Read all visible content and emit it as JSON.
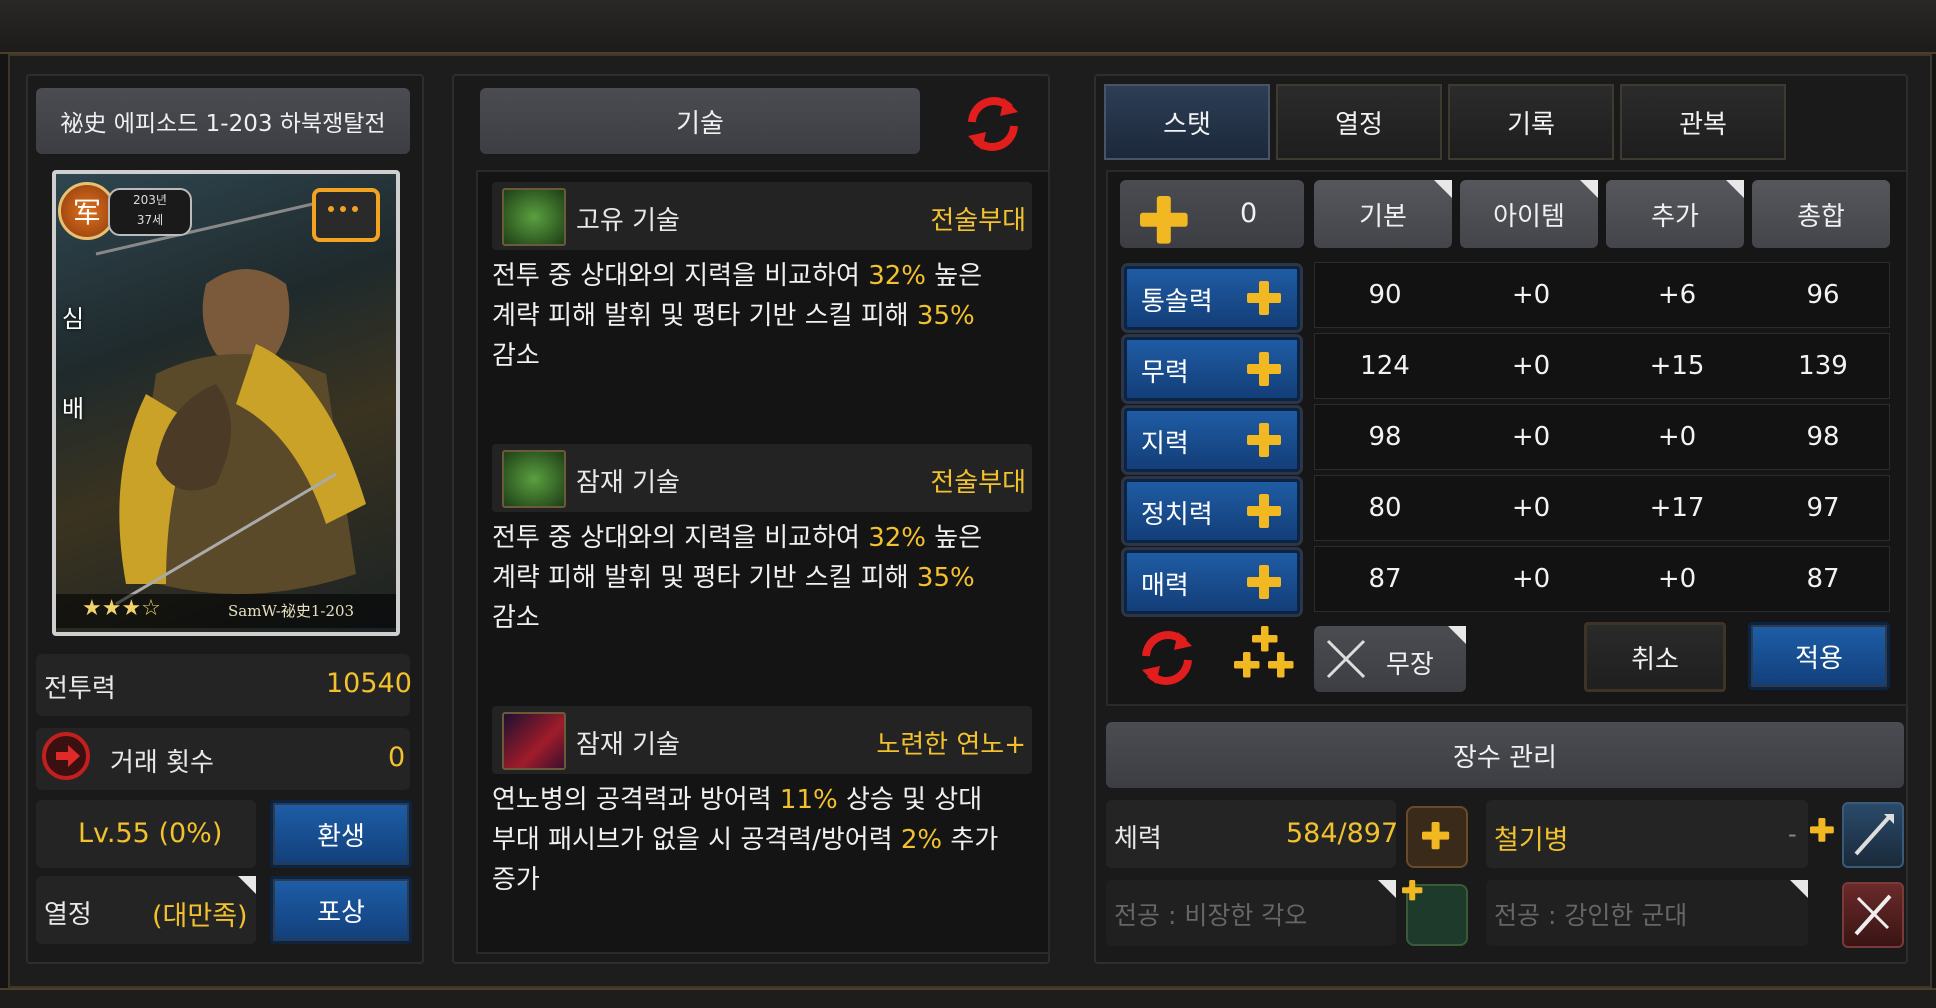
{
  "left": {
    "episode_title": "祕史 에피소드 1-203 하북쟁탈전",
    "card": {
      "badge_char": "军",
      "badge_year": "203년",
      "badge_age": "37세",
      "name_vertical": "심배",
      "stars": "★★★☆",
      "code": "SamW-祕史1-203"
    },
    "combat_power_label": "전투력",
    "combat_power_value": "10540",
    "trade_label": "거래 횟수",
    "trade_value": "0",
    "level": "Lv.55 (0%)",
    "rebirth_button": "환생",
    "passion_label": "열정",
    "passion_value": "(대만족)",
    "reward_button": "포상"
  },
  "middle": {
    "title": "기술",
    "skills": [
      {
        "type": "고유 기술",
        "category": "전술부대",
        "line1_a": "전투 중 상대와의 지력을 비교하여 ",
        "line1_hl": "32%",
        "line1_b": " 높은",
        "line2_a": "계략 피해 발휘 및 평타 기반 스킬 피해 ",
        "line2_hl": "35%",
        "line3": "감소"
      },
      {
        "type": "잠재 기술",
        "category": "전술부대",
        "line1_a": "전투 중 상대와의 지력을 비교하여 ",
        "line1_hl": "32%",
        "line1_b": " 높은",
        "line2_a": "계략 피해 발휘 및 평타 기반 스킬 피해 ",
        "line2_hl": "35%",
        "line3": "감소"
      },
      {
        "type": "잠재 기술",
        "category": "노련한 연노+",
        "line1_a": "연노병의 공격력과 방어력 ",
        "line1_hl": "11%",
        "line1_b": " 상승 및 상대",
        "line2_a": "부대 패시브가 없을 시 공격력/방어력 ",
        "line2_hl": "2%",
        "line2_b": " 추가",
        "line3": "증가"
      }
    ]
  },
  "right": {
    "tabs": [
      "스탯",
      "열정",
      "기록",
      "관복"
    ],
    "points": "0",
    "columns": [
      "기본",
      "아이템",
      "추가",
      "총합"
    ],
    "stats": [
      {
        "name": "통솔력",
        "base": "90",
        "item": "+0",
        "extra": "+6",
        "total": "96"
      },
      {
        "name": "무력",
        "base": "124",
        "item": "+0",
        "extra": "+15",
        "total": "139"
      },
      {
        "name": "지력",
        "base": "98",
        "item": "+0",
        "extra": "+0",
        "total": "98"
      },
      {
        "name": "정치력",
        "base": "80",
        "item": "+0",
        "extra": "+17",
        "total": "97"
      },
      {
        "name": "매력",
        "base": "87",
        "item": "+0",
        "extra": "+0",
        "total": "87"
      }
    ],
    "weapon_label": "무장",
    "cancel_button": "취소",
    "apply_button": "적용",
    "manage_button": "장수 관리",
    "hp_label": "체력",
    "hp_value": "584/897",
    "unit_type": "철기병",
    "unit_dash": "-",
    "special1": "전공 : 비장한 각오",
    "special2": "전공 : 강인한 군대"
  },
  "colors": {
    "gold": "#f2c12e",
    "blue_button": "#1e5ea8",
    "background": "#1d1d1d"
  }
}
